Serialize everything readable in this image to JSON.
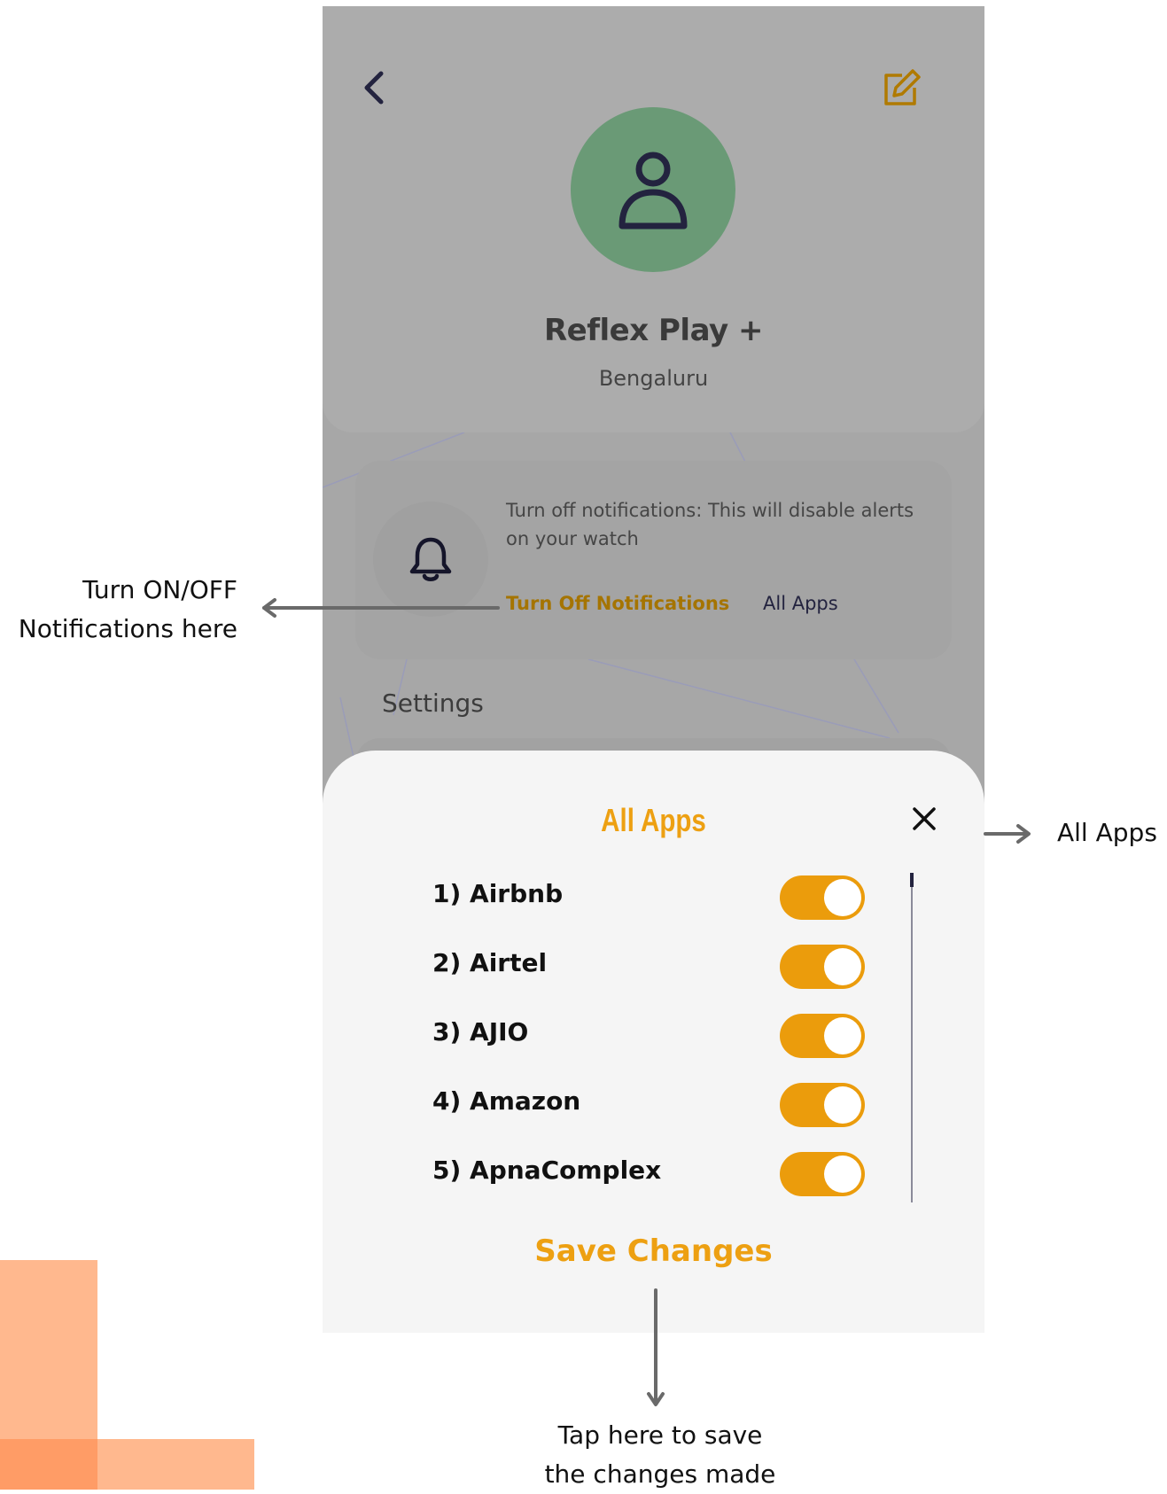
{
  "profile": {
    "name": "Reflex Play +",
    "city": "Bengaluru"
  },
  "notifications": {
    "description": "Turn off notifications: This will disable alerts on your watch",
    "turn_off_label": "Turn Off Notifications",
    "all_apps_label": "All Apps"
  },
  "settings": {
    "heading": "Settings"
  },
  "sheet": {
    "title": "All Apps",
    "apps": [
      {
        "label": "1) Airbnb",
        "enabled": true
      },
      {
        "label": "2) Airtel",
        "enabled": true
      },
      {
        "label": "3) AJIO",
        "enabled": true
      },
      {
        "label": "4) Amazon",
        "enabled": true
      },
      {
        "label": "5) ApnaComplex",
        "enabled": true
      }
    ],
    "save_label": "Save Changes"
  },
  "annotations": {
    "notifications": [
      "Turn ON/OFF",
      "Notifications here"
    ],
    "all_apps": "All Apps",
    "save": [
      "Tap here to save",
      "the changes made"
    ]
  },
  "colors": {
    "accent": "#eda012",
    "avatar": "#6a9a76",
    "dark_navy": "#23233f"
  },
  "icons": {
    "back": "chevron-left-icon",
    "edit": "edit-icon",
    "avatar": "user-icon",
    "bell": "bell-icon",
    "close": "close-icon"
  }
}
